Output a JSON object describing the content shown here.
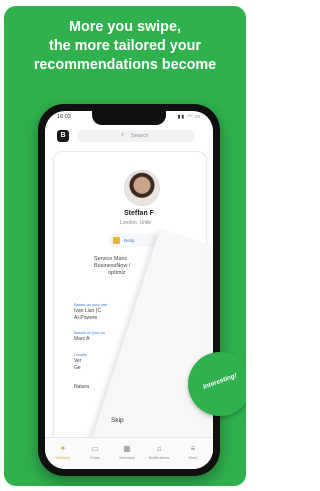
{
  "headline": [
    "More you swipe,",
    "the more tailored your",
    "recommendations become"
  ],
  "phone": {
    "status_time": "16:03",
    "search_placeholder": "Search",
    "profile": {
      "name": "Steffan F",
      "location": "London, Unite",
      "chip_label": "Resp",
      "headline_lines": [
        "Service Manc",
        "BusinessNow /",
        "optimiz"
      ],
      "sections": [
        {
          "label": "Based on your inte",
          "lines": [
            "Ivan Lian (C",
            "AI-Powere"
          ]
        },
        {
          "label": "Based on your ex",
          "lines": [
            "Marc A"
          ]
        },
        {
          "label": "Locatio",
          "lines": [
            "Ver",
            "Ge"
          ]
        },
        {
          "label": "",
          "lines": [
            "Natura"
          ]
        }
      ]
    },
    "badge_text": "Interesting!",
    "skip_label": "Skip",
    "tabs": [
      {
        "label": "Network",
        "icon": "network-icon",
        "glyph": "✦"
      },
      {
        "label": "Chats",
        "icon": "chat-icon",
        "glyph": "▭"
      },
      {
        "label": "Schedule",
        "icon": "calendar-icon",
        "glyph": "▦"
      },
      {
        "label": "Notifications",
        "icon": "bell-icon",
        "glyph": "♫"
      },
      {
        "label": "More",
        "icon": "menu-icon",
        "glyph": "≡"
      }
    ]
  },
  "colors": {
    "brand_green": "#2fb24e",
    "active_tab": "#e2a632"
  }
}
